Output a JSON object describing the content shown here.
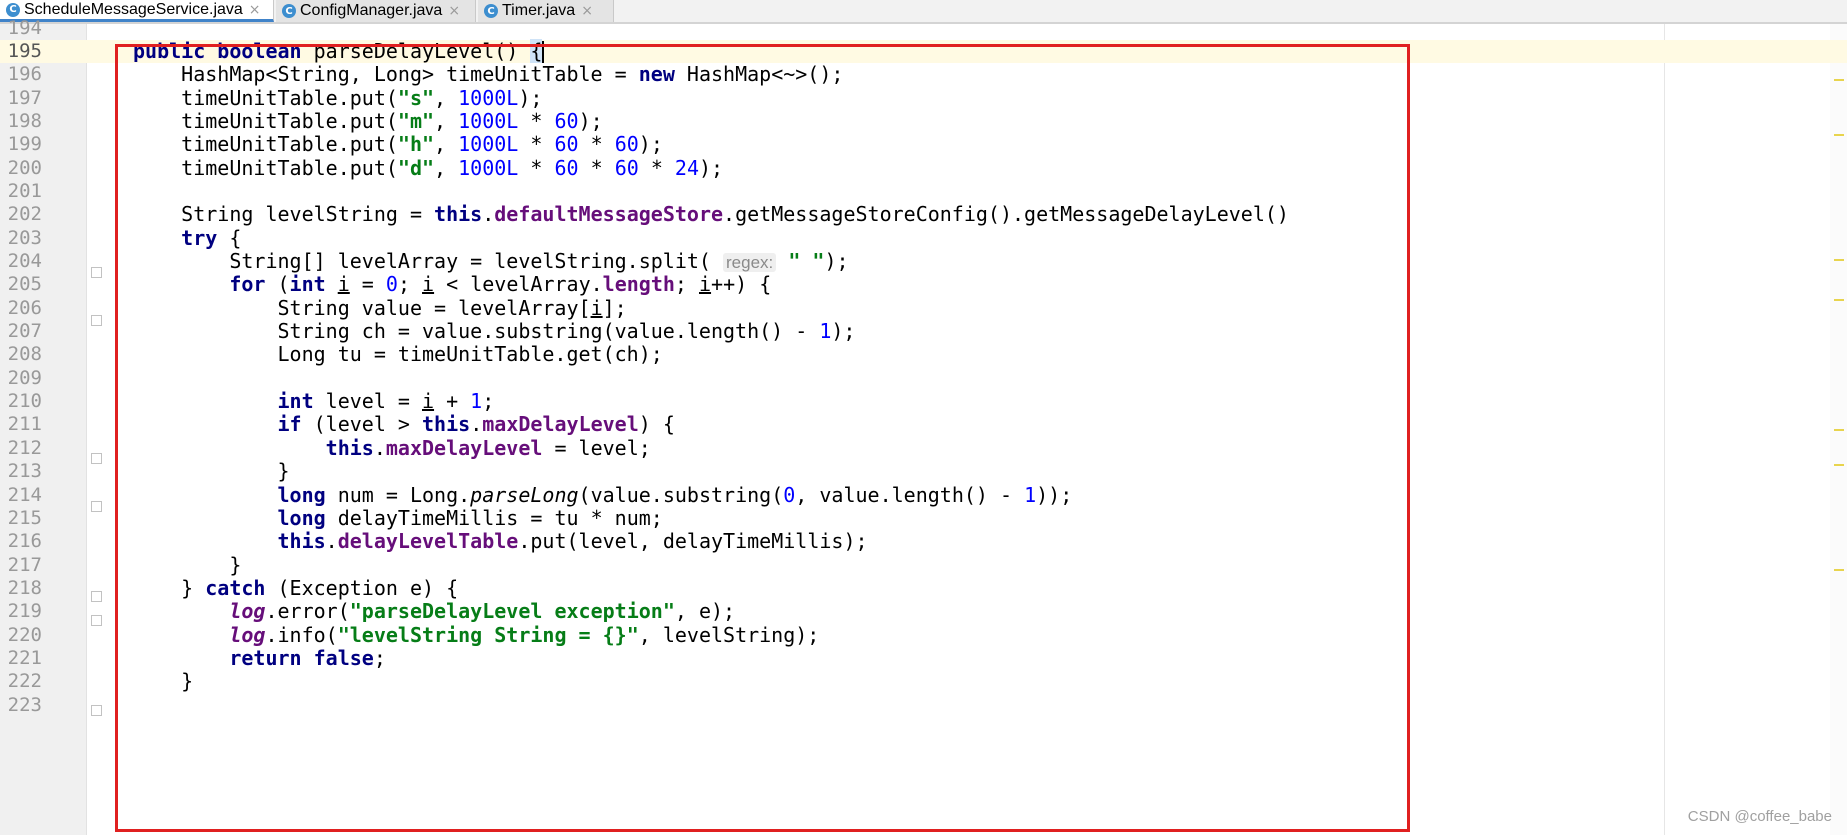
{
  "tabs": [
    {
      "label": "ScheduleMessageService.java",
      "icon": "C",
      "active": true
    },
    {
      "label": "ConfigManager.java",
      "icon": "C",
      "active": false
    },
    {
      "label": "Timer.java",
      "icon": "C",
      "active": false
    }
  ],
  "editor": {
    "current_line": 195,
    "lines": [
      {
        "no": "194",
        "html": ""
      },
      {
        "no": "195",
        "html": "<span class=\"kw\">public</span> <span class=\"kw\">boolean</span> parseDelayLevel() <span class=\"brace-hl\">{</span><span class=\"caret\"></span>"
      },
      {
        "no": "196",
        "html": "    HashMap&lt;String, Long&gt; timeUnitTable = <span class=\"kw\">new</span> HashMap&lt;~&gt;();"
      },
      {
        "no": "197",
        "html": "    timeUnitTable.put(<span class=\"str\">\"s\"</span>, <span class=\"num\">1000L</span>);"
      },
      {
        "no": "198",
        "html": "    timeUnitTable.put(<span class=\"str\">\"m\"</span>, <span class=\"num\">1000L</span> * <span class=\"num\">60</span>);"
      },
      {
        "no": "199",
        "html": "    timeUnitTable.put(<span class=\"str\">\"h\"</span>, <span class=\"num\">1000L</span> * <span class=\"num\">60</span> * <span class=\"num\">60</span>);"
      },
      {
        "no": "200",
        "html": "    timeUnitTable.put(<span class=\"str\">\"d\"</span>, <span class=\"num\">1000L</span> * <span class=\"num\">60</span> * <span class=\"num\">60</span> * <span class=\"num\">24</span>);"
      },
      {
        "no": "201",
        "html": ""
      },
      {
        "no": "202",
        "html": "    String levelString = <span class=\"kw\">this</span>.<span class=\"fld\">defaultMessageStore</span>.getMessageStoreConfig().getMessageDelayLevel()"
      },
      {
        "no": "203",
        "html": "    <span class=\"kw\">try</span> {"
      },
      {
        "no": "204",
        "html": "        String[] levelArray = levelString.split( <span class=\"hint\">regex:</span> <span class=\"str\">\" \"</span>);"
      },
      {
        "no": "205",
        "html": "        <span class=\"kw\">for</span> (<span class=\"kw\">int</span> <span class=\"ul\">i</span> = <span class=\"num\">0</span>; <span class=\"ul\">i</span> &lt; levelArray.<span class=\"fld\">length</span>; <span class=\"ul\">i</span>++) {"
      },
      {
        "no": "206",
        "html": "            String value = levelArray[<span class=\"ul\">i</span>];"
      },
      {
        "no": "207",
        "html": "            String ch = value.substring(value.length() - <span class=\"num\">1</span>);"
      },
      {
        "no": "208",
        "html": "            Long tu = timeUnitTable.get(ch);"
      },
      {
        "no": "209",
        "html": ""
      },
      {
        "no": "210",
        "html": "            <span class=\"kw\">int</span> level = <span class=\"ul\">i</span> + <span class=\"num\">1</span>;"
      },
      {
        "no": "211",
        "html": "            <span class=\"kw\">if</span> (level &gt; <span class=\"kw\">this</span>.<span class=\"fld\">maxDelayLevel</span>) {"
      },
      {
        "no": "212",
        "html": "                <span class=\"kw\">this</span>.<span class=\"fld\">maxDelayLevel</span> = level;"
      },
      {
        "no": "213",
        "html": "            }"
      },
      {
        "no": "214",
        "html": "            <span class=\"kw\">long</span> num = Long.<span class=\"static\">parseLong</span>(value.substring(<span class=\"num\">0</span>, value.length() - <span class=\"num\">1</span>));"
      },
      {
        "no": "215",
        "html": "            <span class=\"kw\">long</span> delayTimeMillis = tu * num;"
      },
      {
        "no": "216",
        "html": "            <span class=\"kw\">this</span>.<span class=\"fld\">delayLevelTable</span>.put(level, delayTimeMillis);"
      },
      {
        "no": "217",
        "html": "        }"
      },
      {
        "no": "218",
        "html": "    } <span class=\"kw\">catch</span> (Exception e) {"
      },
      {
        "no": "219",
        "html": "        <span class=\"fld static\">log</span>.error(<span class=\"str\">\"parseDelayLevel exception\"</span>, e);"
      },
      {
        "no": "220",
        "html": "        <span class=\"fld static\">log</span>.info(<span class=\"str\">\"levelString String = {}\"</span>, levelString);"
      },
      {
        "no": "221",
        "html": "        <span class=\"kw\">return</span> <span class=\"kw\">false</span>;"
      },
      {
        "no": "222",
        "html": "    }"
      },
      {
        "no": "223",
        "html": ""
      }
    ]
  },
  "watermark": "CSDN @coffee_babe"
}
